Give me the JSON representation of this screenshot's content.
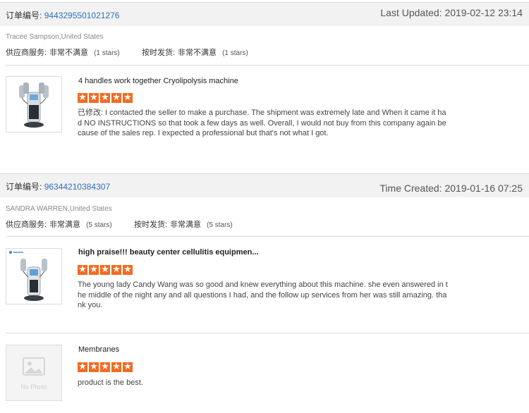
{
  "colors": {
    "accent_link": "#2f6fbf",
    "star_orange": "#f36b21",
    "bar_bg": "#f2f2f2"
  },
  "icons": {
    "rating": "star-icon",
    "no_photo": "image-placeholder-icon"
  },
  "orders": [
    {
      "order_label": "订单编号:",
      "order_number": "9443295501021276",
      "date_text": "Last Updated: 2019-02-12 23:14",
      "buyer": "Tracee Sampson,United States",
      "rating_supplier_label": "供应商服务:",
      "rating_supplier_value": "非常不满意",
      "rating_supplier_stars": "(1 stars)",
      "rating_ontime_label": "按时发货:",
      "rating_ontime_value": "非常不满意",
      "rating_ontime_stars": "(1 stars)",
      "reviews": [
        {
          "title": "4 handles work together Cryolipolysis machine",
          "star_count": 5,
          "text": "已修改: I contacted the seller to make a purchase. The shipment was extremely late and When it came it had NO INSTRUCTIONS so that took a few days as well. Overall, I would not buy from this company again because of the sales rep. I expected a professional but that's not what I got."
        }
      ]
    },
    {
      "order_label": "订单编号:",
      "order_number": "96344210384307",
      "date_text": "Time Created: 2019-01-16 07:25",
      "buyer": "SANDRA WARREN,United States",
      "rating_supplier_label": "供应商服务:",
      "rating_supplier_value": "非常满意",
      "rating_supplier_stars": "(5 stars)",
      "rating_ontime_label": "按时发货:",
      "rating_ontime_value": "非常满意",
      "rating_ontime_stars": "(5 stars)",
      "reviews": [
        {
          "title": "high praise!!! beauty center cellulitis equipmen...",
          "star_count": 5,
          "text": "The young lady Candy Wang was so good and knew everything about this machine. she even answered in the middle of the night any and all questions I had, and the follow up services from her was still amazing. thank you."
        },
        {
          "title": "Membranes",
          "star_count": 5,
          "text": "product is the best.",
          "thumb_text": "No Photo"
        }
      ]
    }
  ]
}
